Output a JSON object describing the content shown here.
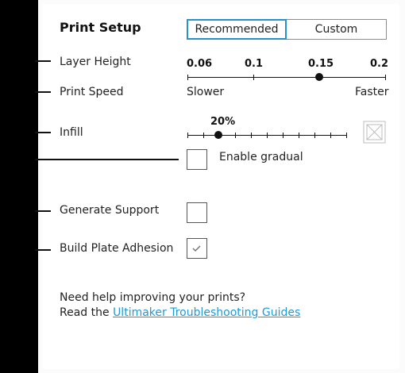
{
  "print_setup": {
    "title": "Print Setup",
    "tabs": [
      {
        "label": "Recommended",
        "active": true
      },
      {
        "label": "Custom",
        "active": false
      }
    ]
  },
  "layer_height": {
    "label": "Layer Height",
    "options": [
      "0.06",
      "0.1",
      "0.15",
      "0.2"
    ],
    "selected": "0.15"
  },
  "print_speed": {
    "label": "Print Speed",
    "min_label": "Slower",
    "max_label": "Faster"
  },
  "infill": {
    "label": "Infill",
    "value": "20%",
    "value_fraction": 0.2,
    "icon": "infill-pattern-icon"
  },
  "enable_gradual": {
    "label": "Enable gradual",
    "checked": false
  },
  "generate_support": {
    "label": "Generate Support",
    "checked": false
  },
  "build_plate_adhesion": {
    "label": "Build Plate Adhesion",
    "checked": true
  },
  "help": {
    "line1": "Need help improving your prints?",
    "line2_prefix": "Read the",
    "link_text": "Ultimaker Troubleshooting Guides"
  },
  "colors": {
    "accent": "#2a90c9",
    "link": "#1d9ad6"
  }
}
